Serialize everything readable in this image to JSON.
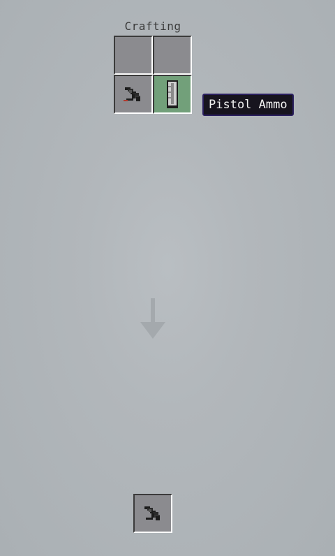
{
  "panel": {
    "title": "Crafting"
  },
  "grid": {
    "slots": [
      {
        "item": "",
        "icon": "empty-slot"
      },
      {
        "item": "",
        "icon": "empty-slot"
      },
      {
        "item": "Pistol",
        "icon": "pistol-icon"
      },
      {
        "item": "Pistol Ammo",
        "icon": "ammo-magazine-icon",
        "hovered": true
      }
    ]
  },
  "tooltip": {
    "text": "Pistol Ammo"
  },
  "result": {
    "item": "Pistol",
    "icon": "pistol-icon"
  },
  "colors": {
    "background": "#b2b7bb",
    "slot": "#8b8b8f",
    "slot_hover": "#72a07a",
    "tooltip_bg": "#17141e",
    "tooltip_border": "#2a1f5e"
  }
}
